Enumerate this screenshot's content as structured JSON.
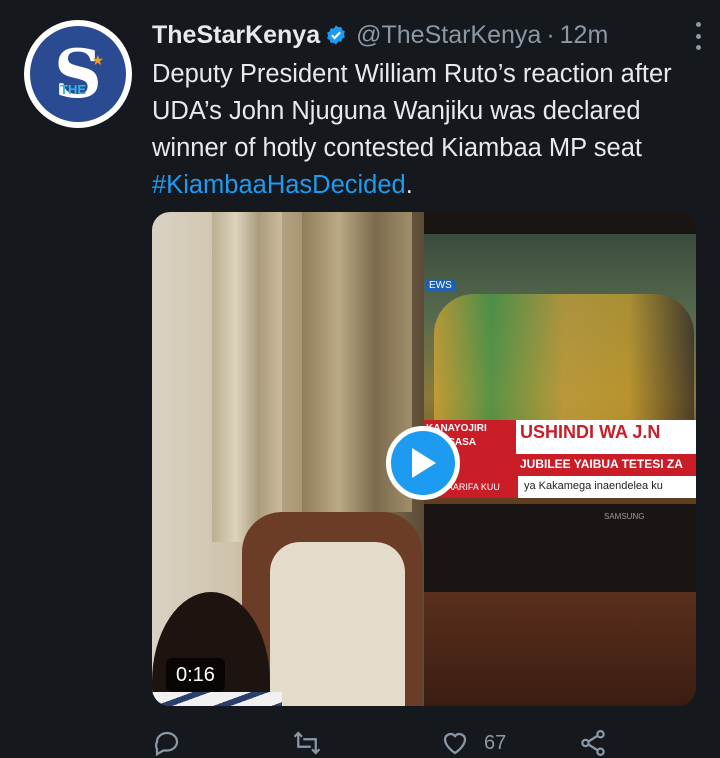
{
  "tweet": {
    "account_name": "TheStarKenya",
    "handle": "@TheStarKenya",
    "separator": "·",
    "time": "12m",
    "text_main": "Deputy President William Ruto’s reaction after UDA’s John Njuguna Wanjiku was declared winner of hotly contested Kiambaa MP seat ",
    "hashtag": "#KiambaaHasDecided",
    "text_end": "."
  },
  "avatar": {
    "letter": "S",
    "small_text": "THE"
  },
  "video": {
    "duration": "0:16",
    "tv_news_label": "EWS",
    "ticker_left": "KANAYOJIRI\nHIVI SASA",
    "ticker_main": "USHINDI WA J.N",
    "ticker_sub": "JUBILEE YAIBUA TETESI ZA",
    "ticker_bar_label": "TAARIFA KUU",
    "ticker_bar": "ya Kakamega inaendelea ku",
    "tv_brand": "SAMSUNG"
  },
  "actions": {
    "like_count": "67"
  },
  "colors": {
    "background": "#15181c",
    "accent": "#1d9bf0",
    "secondary_text": "#8b98a5"
  }
}
